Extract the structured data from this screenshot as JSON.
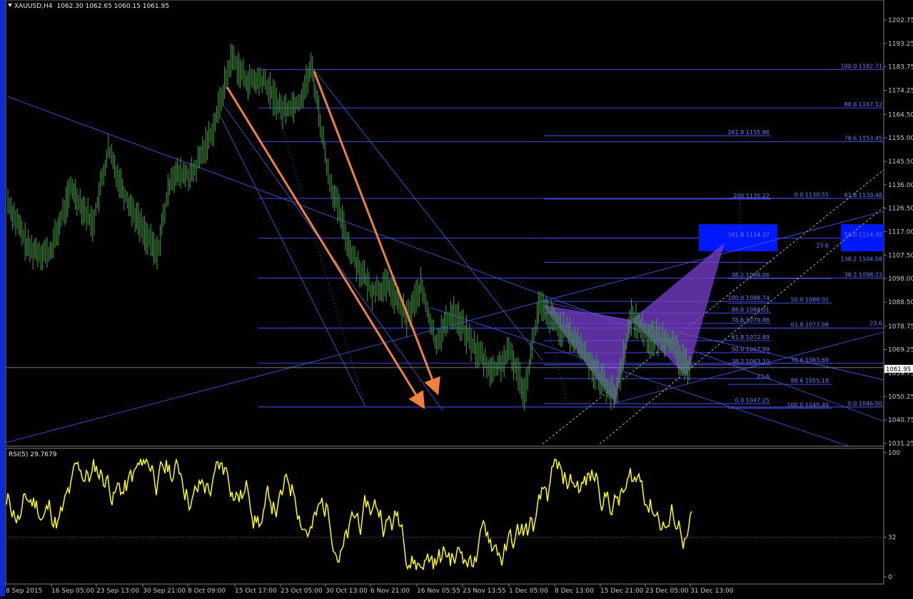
{
  "window": {
    "symbol_header": "XAUUSD,H4",
    "ohlc": "1062.30 1062.65 1060.15 1061.95",
    "current_price": "1061.95"
  },
  "chart_data": [
    {
      "type": "line",
      "name": "price",
      "ylim": [
        1031.25,
        1207.0
      ],
      "y_ticks": [
        "1202.75",
        "1193.25",
        "1183.75",
        "1174.25",
        "1164.50",
        "1155.00",
        "1145.50",
        "1136.00",
        "1126.50",
        "1117.00",
        "1107.50",
        "1098.00",
        "1088.50",
        "1078.75",
        "1069.25",
        "1059.75",
        "1050.25",
        "1040.75",
        "1031.25"
      ],
      "x_ticks": [
        "8 Sep 2015",
        "16 Sep 05:00",
        "23 Sep 13:00",
        "30 Sep 21:00",
        "8 Oct 09:00",
        "15 Oct 17:00",
        "23 Oct 05:00",
        "30 Oct 13:00",
        "6 Nov 21:00",
        "16 Nov 05:55",
        "23 Nov 13:55",
        "1 Dec 05:00",
        "8 Dec 13:00",
        "15 Dec 21:00",
        "23 Dec 05:00",
        "31 Dec 13:00"
      ],
      "fib_labels": [
        {
          "text": "100.0 1182.71",
          "y": 1182.71
        },
        {
          "text": "88.6 1167.12",
          "y": 1167.12
        },
        {
          "text": "261.8 1155.86",
          "y": 1155.86
        },
        {
          "text": "78.6 1153.45",
          "y": 1153.45
        },
        {
          "text": "200 1130.22",
          "y": 1130.22
        },
        {
          "text": "0.0 1130.55",
          "y": 1130.55
        },
        {
          "text": "61.8 1130.48",
          "y": 1130.48
        },
        {
          "text": "161.8 1114.37",
          "y": 1114.37
        },
        {
          "text": "50.0 1114.35",
          "y": 1114.35
        },
        {
          "text": "23.6",
          "y": 1110.0
        },
        {
          "text": "138.2 1104.58",
          "y": 1104.58
        },
        {
          "text": "38.2 1098.06",
          "y": 1098.06
        },
        {
          "text": "38.2 1098.22",
          "y": 1098.22
        },
        {
          "text": "100.0 1088.74",
          "y": 1088.74
        },
        {
          "text": "50.0 1088.02",
          "y": 1088.02
        },
        {
          "text": "88.6 1084.01",
          "y": 1084.01
        },
        {
          "text": "78.6 1079.86",
          "y": 1079.86
        },
        {
          "text": "61.8 1077.98",
          "y": 1077.98
        },
        {
          "text": "23.6",
          "y": 1078.6
        },
        {
          "text": "61.8 1072.89",
          "y": 1072.89
        },
        {
          "text": "50.0 1067.99",
          "y": 1067.99
        },
        {
          "text": "38.2 1063.10",
          "y": 1063.1
        },
        {
          "text": "78.6 1063.69",
          "y": 1063.69
        },
        {
          "text": "23.6",
          "y": 1057.0
        },
        {
          "text": "88.6 1055.19",
          "y": 1055.19
        },
        {
          "text": "0.0 1047.25",
          "y": 1047.25
        },
        {
          "text": "100.0 1045.49",
          "y": 1045.49
        },
        {
          "text": "0.0 1046.00",
          "y": 1046.0
        }
      ]
    },
    {
      "type": "line",
      "name": "RSI(5)",
      "label": "RSI(5) 29.7679",
      "ylim": [
        0,
        100
      ],
      "y_ticks": [
        "100",
        "32",
        "0"
      ]
    }
  ],
  "colors": {
    "background": "#000000",
    "candles": "#3da63d",
    "fib_lines": "#4a55ff",
    "trend_lines": "#3a57d8",
    "arrows": "#f0803a",
    "pattern_fill": "#7a3fd0",
    "rsi_line": "#ffff00",
    "box": "#0018ff"
  }
}
